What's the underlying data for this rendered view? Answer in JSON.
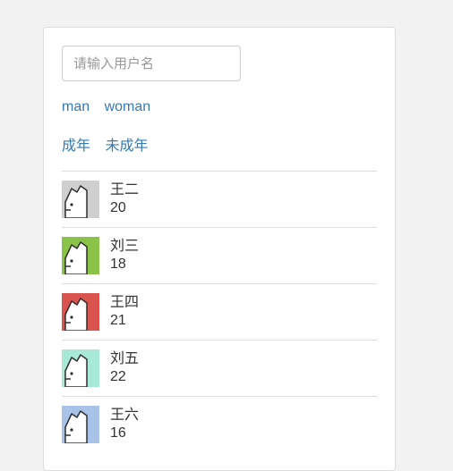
{
  "search": {
    "placeholder": "请输入用户名",
    "value": ""
  },
  "filters": {
    "gender": [
      {
        "label": "man"
      },
      {
        "label": "woman"
      }
    ],
    "age_group": [
      {
        "label": "成年"
      },
      {
        "label": "未成年"
      }
    ]
  },
  "users": [
    {
      "name": "王二",
      "age": "20",
      "avatar_bg": "#cfcfcf"
    },
    {
      "name": "刘三",
      "age": "18",
      "avatar_bg": "#8bc34a"
    },
    {
      "name": "王四",
      "age": "21",
      "avatar_bg": "#d9534f"
    },
    {
      "name": "刘五",
      "age": "22",
      "avatar_bg": "#a7e8d6"
    },
    {
      "name": "王六",
      "age": "16",
      "avatar_bg": "#a9c3e8"
    }
  ]
}
